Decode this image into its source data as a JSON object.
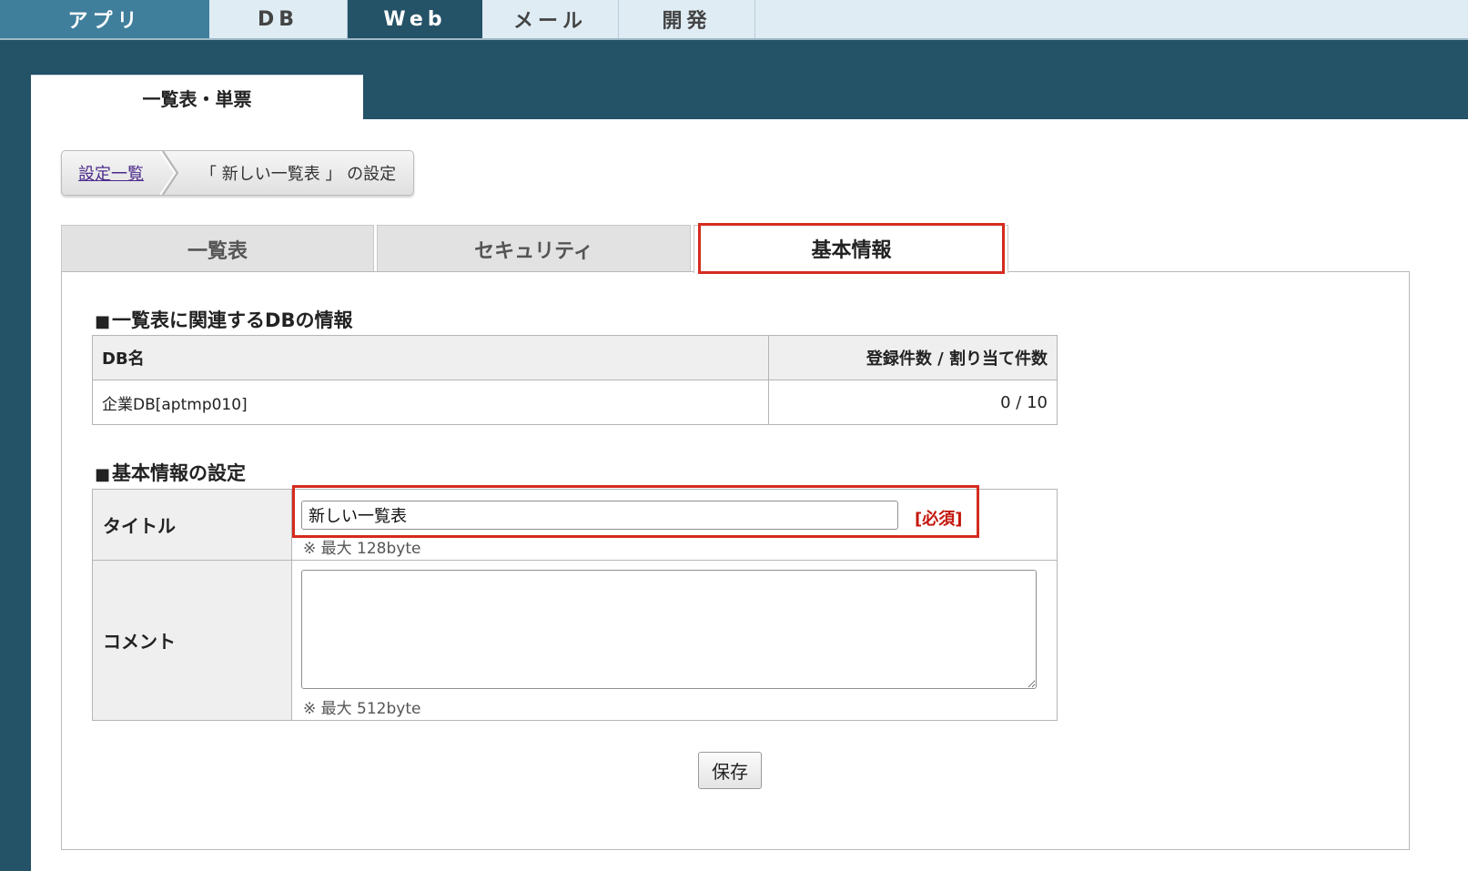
{
  "topnav": {
    "tabs": [
      "アプリ",
      "DB",
      "Web",
      "メール",
      "開発"
    ],
    "active": "Web"
  },
  "panel_tab": "一覧表・単票",
  "breadcrumb": {
    "link": "設定一覧",
    "current": "「 新しい一覧表 」 の設定"
  },
  "tabs": {
    "list": "一覧表",
    "security": "セキュリティ",
    "basic": "基本情報",
    "active": "基本情報"
  },
  "db_section": {
    "title": "一覧表に関連するDBの情報",
    "columns": [
      "DB名",
      "登録件数 / 割り当て件数"
    ],
    "rows": [
      {
        "name": "企業DB[aptmp010]",
        "count": "0 / 10"
      }
    ]
  },
  "basic_section": {
    "title": "基本情報の設定",
    "title_label": "タイトル",
    "title_value": "新しい一覧表",
    "required": "[必須]",
    "title_hint": "※ 最大 128byte",
    "comment_label": "コメント",
    "comment_value": "",
    "comment_hint": "※ 最大 512byte"
  },
  "save_label": "保存",
  "colors": {
    "background": "#245267",
    "nav_app": "#3f7f9c",
    "nav_active": "#245267",
    "highlight": "#d52b1e",
    "required": "#c4170c"
  },
  "section_marker": "■"
}
